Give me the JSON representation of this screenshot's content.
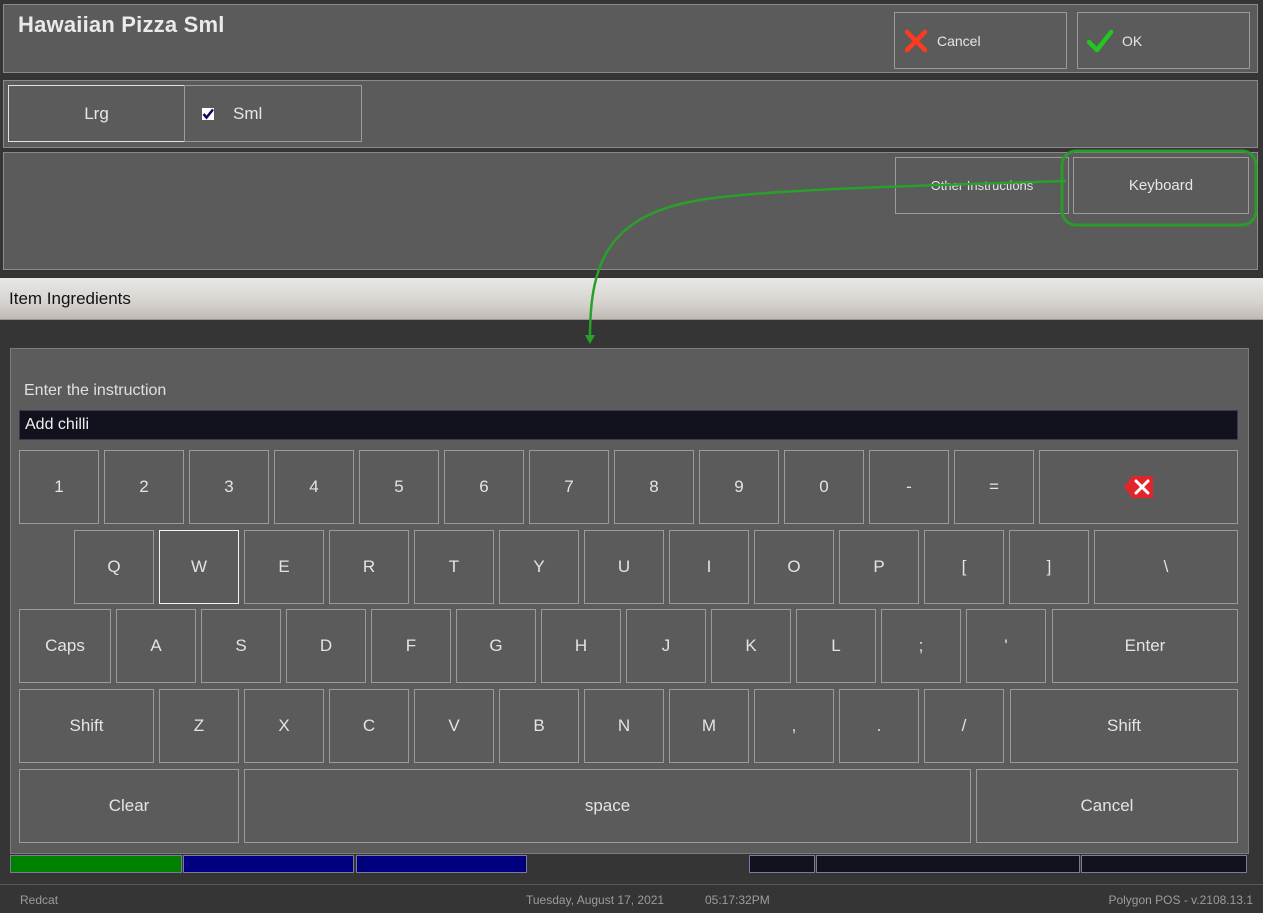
{
  "header": {
    "title": "Hawaiian Pizza Sml",
    "cancel_label": "Cancel",
    "ok_label": "OK"
  },
  "sizes": [
    {
      "label": "Lrg",
      "checked": false
    },
    {
      "label": "Sml",
      "checked": true
    }
  ],
  "instructions": {
    "other_label": "Other Instructions",
    "keyboard_label": "Keyboard"
  },
  "section": {
    "title": "Item Ingredients"
  },
  "keyboard": {
    "prompt": "Enter the instruction",
    "input_value": "Add chilli",
    "rows": [
      [
        "1",
        "2",
        "3",
        "4",
        "5",
        "6",
        "7",
        "8",
        "9",
        "0",
        "-",
        "=",
        "backspace"
      ],
      [
        "Q",
        "W",
        "E",
        "R",
        "T",
        "Y",
        "U",
        "I",
        "O",
        "P",
        "[",
        "]",
        "\\"
      ],
      [
        "Caps",
        "A",
        "S",
        "D",
        "F",
        "G",
        "H",
        "J",
        "K",
        "L",
        ";",
        "'",
        "Enter"
      ],
      [
        "Shift",
        "Z",
        "X",
        "C",
        "V",
        "B",
        "N",
        "M",
        ",",
        ".",
        "/",
        "Shift"
      ],
      [
        "Clear",
        "space",
        "Cancel"
      ]
    ],
    "focused_key": "W"
  },
  "color_strip": {
    "segments": [
      "#008000",
      "#00007f",
      "#00007f",
      "",
      "#12121f",
      "#12121f",
      "#12121f"
    ]
  },
  "status_bar": {
    "left": "Redcat",
    "date": "Tuesday, August 17, 2021",
    "time": "05:17:32PM",
    "version": "Polygon POS - v.2108.13.1"
  },
  "annotation": {
    "color": "#2a9a2a",
    "highlighted": "Keyboard"
  }
}
